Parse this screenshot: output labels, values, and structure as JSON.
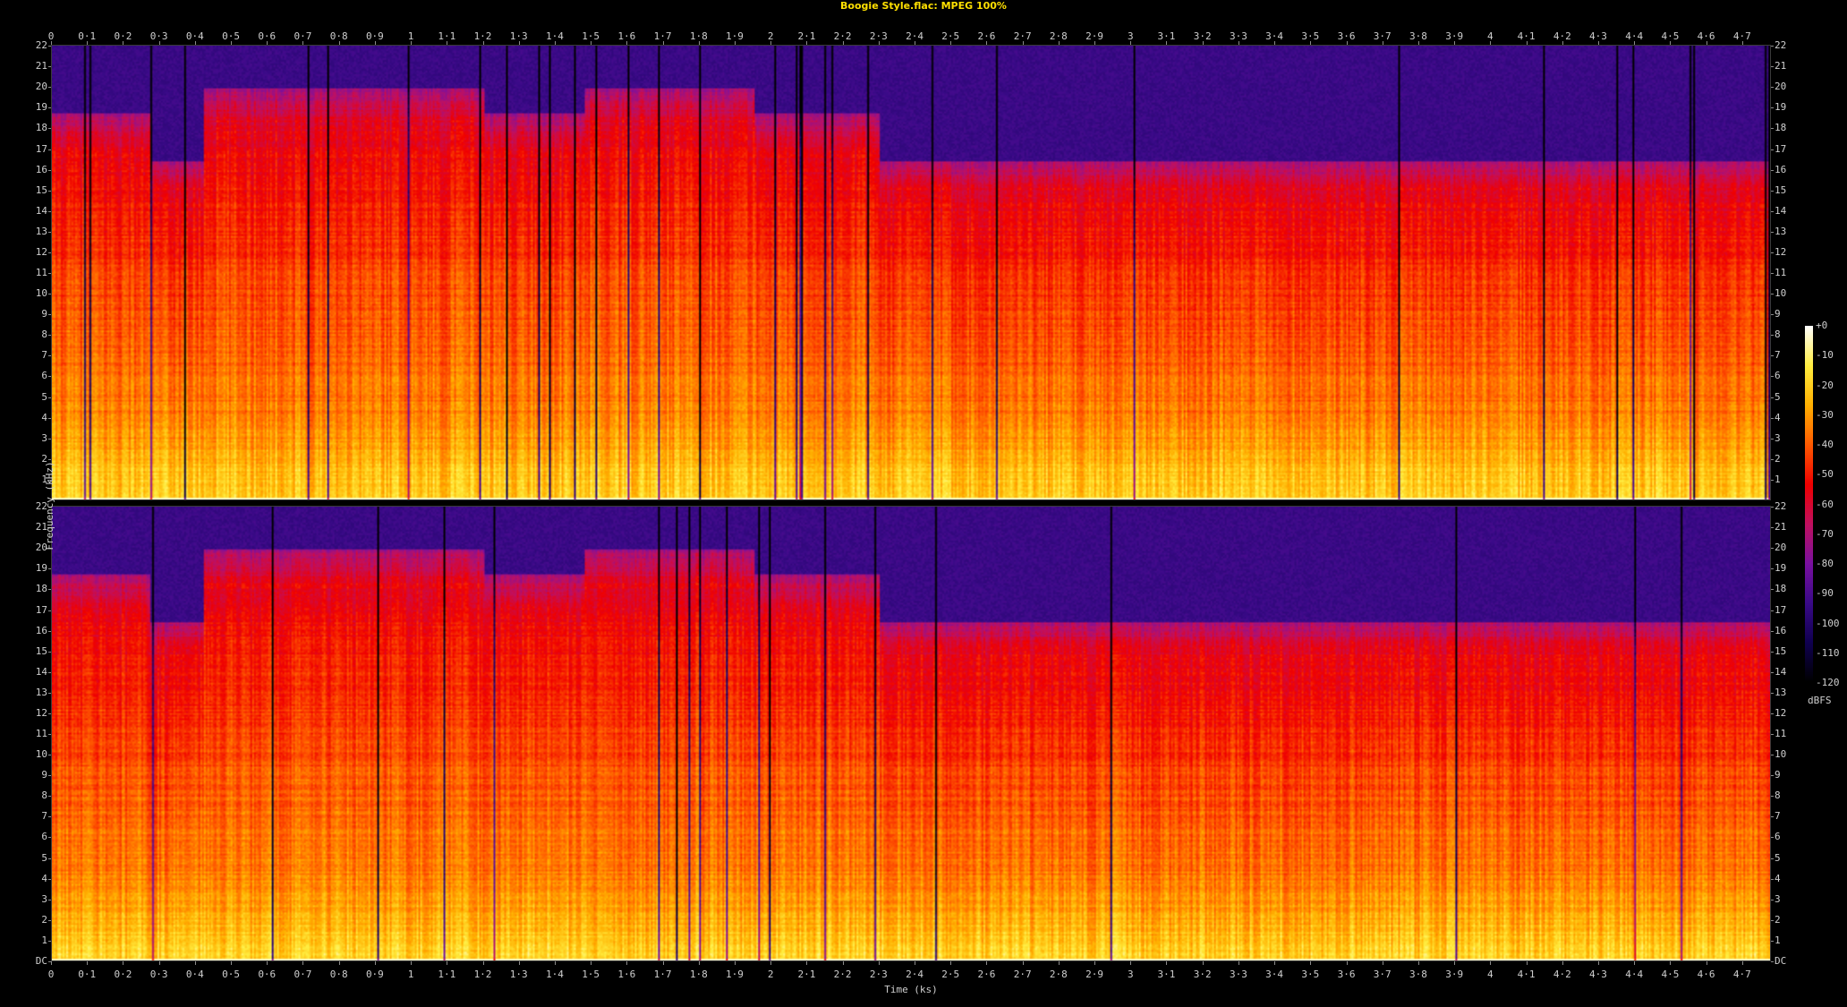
{
  "title": "Boogie Style.flac: MPEG 100%",
  "chart_data": {
    "type": "heatmap",
    "subtype": "spectrogram",
    "channels": 2,
    "title": "Boogie Style.flac: MPEG 100%",
    "xlabel": "Time (ks)",
    "ylabel": "Frequency (kHz)",
    "x_ticks": [
      "0",
      "0·1",
      "0·2",
      "0·3",
      "0·4",
      "0·5",
      "0·6",
      "0·7",
      "0·8",
      "0·9",
      "1",
      "1·1",
      "1·2",
      "1·3",
      "1·4",
      "1·5",
      "1·6",
      "1·7",
      "1·8",
      "1·9",
      "2",
      "2·1",
      "2·2",
      "2·3",
      "2·4",
      "2·5",
      "2·6",
      "2·7",
      "2·8",
      "2·9",
      "3",
      "3·1",
      "3·2",
      "3·3",
      "3·4",
      "3·5",
      "3·6",
      "3·7",
      "3·8",
      "3·9",
      "4",
      "4·1",
      "4·2",
      "4·3",
      "4·4",
      "4·5",
      "4·6",
      "4·7"
    ],
    "x_tick_values": [
      0,
      0.1,
      0.2,
      0.3,
      0.4,
      0.5,
      0.6,
      0.7,
      0.8,
      0.9,
      1,
      1.1,
      1.2,
      1.3,
      1.4,
      1.5,
      1.6,
      1.7,
      1.8,
      1.9,
      2,
      2.1,
      2.2,
      2.3,
      2.4,
      2.5,
      2.6,
      2.7,
      2.8,
      2.9,
      3,
      3.1,
      3.2,
      3.3,
      3.4,
      3.5,
      3.6,
      3.7,
      3.8,
      3.9,
      4,
      4.1,
      4.2,
      4.3,
      4.4,
      4.5,
      4.6,
      4.7
    ],
    "xlim": [
      0,
      4.78
    ],
    "y_ticks_top": [
      "22",
      "21",
      "20",
      "19",
      "18",
      "17",
      "16",
      "15",
      "14",
      "13",
      "12",
      "11",
      "10",
      "9",
      "8",
      "7",
      "6",
      "5",
      "4",
      "3",
      "2",
      "1"
    ],
    "y_ticks_bottom": [
      "22",
      "21",
      "20",
      "19",
      "18",
      "17",
      "16",
      "15",
      "14",
      "13",
      "12",
      "11",
      "10",
      "9",
      "8",
      "7",
      "6",
      "5",
      "4",
      "3",
      "2",
      "1",
      "DC"
    ],
    "ylim": [
      0,
      22.05
    ],
    "colorbar": {
      "label": "dBFS",
      "ticks": [
        "+0",
        "-10",
        "-20",
        "-30",
        "-40",
        "-50",
        "-60",
        "-70",
        "-80",
        "-90",
        "-100",
        "-110",
        "-120"
      ],
      "range": [
        -120,
        0
      ],
      "colors": [
        "#000000",
        "#100050",
        "#3a0a88",
        "#7a10a0",
        "#c01060",
        "#f00000",
        "#ff5a00",
        "#ffb000",
        "#ffee40",
        "#ffffff"
      ]
    },
    "cutoff_segments_khz": [
      {
        "t_start": 0.0,
        "t_end": 0.27,
        "cutoff": 18.8
      },
      {
        "t_start": 0.27,
        "t_end": 0.42,
        "cutoff": 16.5
      },
      {
        "t_start": 0.42,
        "t_end": 0.9,
        "cutoff": 20.0
      },
      {
        "t_start": 0.9,
        "t_end": 1.2,
        "cutoff": 20.0
      },
      {
        "t_start": 1.2,
        "t_end": 1.48,
        "cutoff": 18.8
      },
      {
        "t_start": 1.48,
        "t_end": 1.95,
        "cutoff": 20.0
      },
      {
        "t_start": 1.95,
        "t_end": 2.3,
        "cutoff": 18.8
      },
      {
        "t_start": 2.3,
        "t_end": 4.78,
        "cutoff": 16.5
      }
    ]
  },
  "colors": {
    "background": "#000000",
    "title": "#ffe000",
    "text": "#cfcfcf"
  }
}
